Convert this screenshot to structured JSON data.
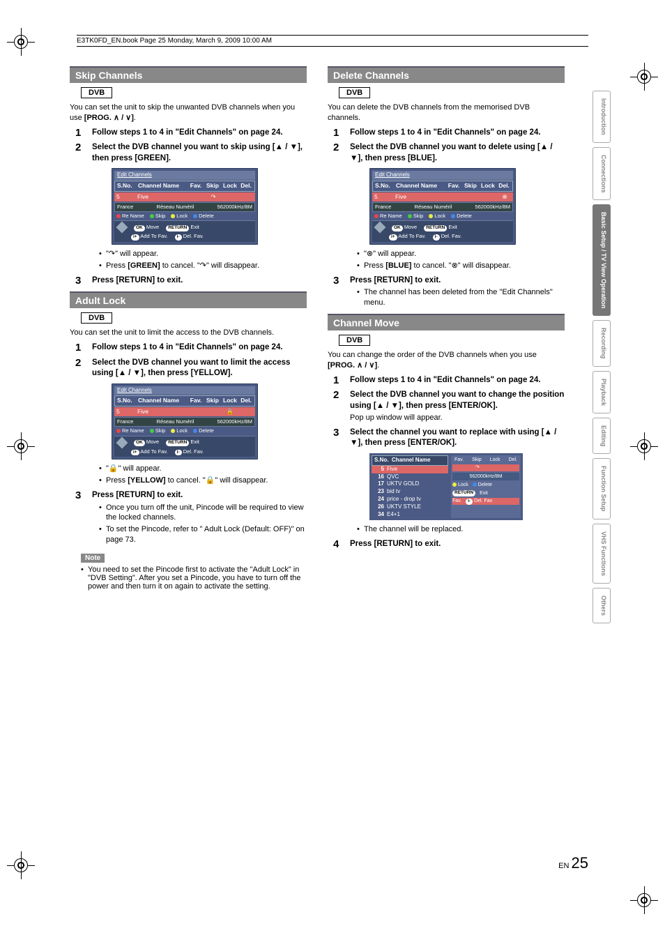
{
  "header": {
    "book_line": "E3TK0FD_EN.book  Page 25  Monday, March 9, 2009  10:00 AM"
  },
  "page": {
    "lang": "EN",
    "number": "25"
  },
  "tabs": [
    {
      "label": "Introduction",
      "active": false
    },
    {
      "label": "Connections",
      "active": false
    },
    {
      "label": "Basic Setup /\nTV View Operation",
      "active": true
    },
    {
      "label": "Recording",
      "active": false
    },
    {
      "label": "Playback",
      "active": false
    },
    {
      "label": "Editing",
      "active": false
    },
    {
      "label": "Function Setup",
      "active": false
    },
    {
      "label": "VHS Functions",
      "active": false
    },
    {
      "label": "Others",
      "active": false
    }
  ],
  "sections": {
    "skip": {
      "title": "Skip Channels",
      "badge": "DVB",
      "intro_a": "You can set the unit to skip the unwanted DVB channels when you use ",
      "intro_b": "[PROG. ∧ / ∨]",
      "step1": "Follow steps 1 to 4 in \"Edit Channels\" on page 24.",
      "step2": "Select the DVB channel you want to skip using [▲ / ▼], then press [GREEN].",
      "after_b1": "\"↷\" will appear.",
      "after_b2_a": "Press ",
      "after_b2_b": "[GREEN]",
      "after_b2_c": " to cancel. \"↷\" will disappear.",
      "step3": "Press [RETURN] to exit."
    },
    "adult": {
      "title": "Adult Lock",
      "badge": "DVB",
      "intro": "You can set the unit to limit the access to the DVB channels.",
      "step1": "Follow steps 1 to 4 in \"Edit Channels\" on page 24.",
      "step2": "Select the DVB channel you want to limit the access using [▲ / ▼], then press [YELLOW].",
      "after_b1": "\"🔒\" will appear.",
      "after_b2_a": "Press ",
      "after_b2_b": "[YELLOW]",
      "after_b2_c": " to cancel. \"🔒\" will disappear.",
      "step3": "Press [RETURN] to exit.",
      "step3_b1": "Once you turn off the unit, Pincode will be required to view the locked channels.",
      "step3_b2": "To set the Pincode, refer to \"  Adult Lock (Default: OFF)\" on page 73.",
      "note_label": "Note",
      "note_text": "You need to set the Pincode first to activate the \"Adult Lock\" in \"DVB Setting\". After you set a Pincode, you have to turn off the power and then turn it on again to activate the setting."
    },
    "delete": {
      "title": "Delete Channels",
      "badge": "DVB",
      "intro": "You can delete the DVB channels from the memorised DVB channels.",
      "step1": "Follow steps 1 to 4 in \"Edit Channels\" on page 24.",
      "step2": "Select the DVB channel you want to delete using [▲ / ▼], then press [BLUE].",
      "after_b1": "\"⊗\" will appear.",
      "after_b2_a": "Press ",
      "after_b2_b": "[BLUE]",
      "after_b2_c": " to cancel. \"⊗\" will disappear.",
      "step3": "Press [RETURN] to exit.",
      "step3_b1": "The channel has been deleted from the \"Edit Channels\" menu."
    },
    "move": {
      "title": "Channel Move",
      "badge": "DVB",
      "intro_a": "You can change the order of the DVB channels when you use ",
      "intro_b": "[PROG. ∧ / ∨]",
      "step1": "Follow steps 1 to 4 in \"Edit Channels\" on page 24.",
      "step2": "Select the DVB channel you want to change the position using [▲ / ▼], then press [ENTER/OK].",
      "step2_sub": "Pop up window will appear.",
      "step3": "Select the channel you want to replace with using [▲ / ▼], then press [ENTER/OK].",
      "after_b1": "The channel will be replaced.",
      "step4": "Press [RETURN] to exit."
    }
  },
  "osd": {
    "title": "Edit Channels",
    "header": {
      "sno": "S.No.",
      "name": "Channel Name",
      "fav": "Fav.",
      "skip": "Skip",
      "lock": "Lock",
      "del": "Del."
    },
    "row": {
      "sno": "5",
      "name": "Five"
    },
    "band": {
      "country": "France",
      "net": "Réseau Numéril",
      "freq": "562000kHz/8M"
    },
    "legend": {
      "rename": "Re Name",
      "skip": "Skip",
      "lock": "Lock",
      "delete": "Delete"
    },
    "controls": {
      "ok": "OK",
      "move": "Move",
      "return": "RETURN",
      "exit": "Exit",
      "addfav": "Add To Fav.",
      "delfav": "Del. Fav."
    },
    "icon_skip": "↷",
    "icon_lock": "🔒",
    "icon_del": "⊗"
  },
  "osd_move": {
    "header": {
      "sno": "S.No.",
      "name": "Channel Name"
    },
    "rows": [
      {
        "no": "5",
        "name": "Five"
      },
      {
        "no": "16",
        "name": "QVC"
      },
      {
        "no": "17",
        "name": "UKTV GOLD"
      },
      {
        "no": "23",
        "name": "bid tv"
      },
      {
        "no": "24",
        "name": "price - drop tv"
      },
      {
        "no": "26",
        "name": "UKTV STYLE"
      },
      {
        "no": "34",
        "name": "E4+1"
      }
    ],
    "panel": {
      "fav": "Fav.",
      "skip": "Skip",
      "lock": "Lock",
      "del": "Del.",
      "icon": "↷",
      "freq": "562000kHz/8M",
      "legend_lock": "Lock",
      "legend_del": "Delete",
      "return": "RETURN",
      "exit": "Exit",
      "fav_btn": "Fav.",
      "delfav": "Del. Fav."
    }
  }
}
